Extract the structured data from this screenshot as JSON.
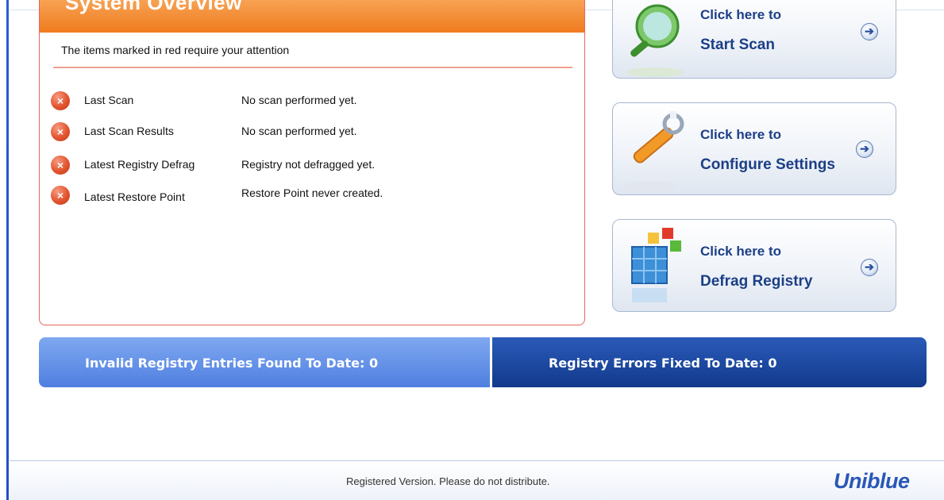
{
  "overview": {
    "title": "System Overview",
    "notice": "The items marked in red require your attention",
    "items": [
      {
        "label": "Last Scan",
        "value": "No scan performed yet."
      },
      {
        "label": "Last Scan Results",
        "value": "No scan performed yet."
      },
      {
        "label": "Latest Registry Defrag",
        "value": "Registry not defragged yet."
      },
      {
        "label": "Latest Restore Point",
        "value": "Restore Point never created."
      }
    ]
  },
  "actions": {
    "scan": {
      "line1": "Click here to",
      "line2": "Start Scan"
    },
    "settings": {
      "line1": "Click here to",
      "line2": "Configure Settings"
    },
    "defrag": {
      "line1": "Click here to",
      "line2": "Defrag Registry"
    }
  },
  "counters": {
    "invalid_found": "Invalid Registry Entries Found To Date: 0",
    "errors_fixed": "Registry Errors Fixed To Date: 0"
  },
  "footer": {
    "text": "Registered Version. Please do not distribute.",
    "brand": "Uniblue"
  },
  "colors": {
    "header_orange": "#f07b1e",
    "error_red": "#e2542f",
    "counter_light": "#4f7fe0",
    "counter_dark": "#123a8c",
    "button_text": "#1c3f86",
    "brand_blue": "#2a57b8"
  },
  "icons": [
    "error-icon",
    "magnifier-icon",
    "wrench-icon",
    "registry-cubes-icon",
    "arrow-right-icon"
  ]
}
